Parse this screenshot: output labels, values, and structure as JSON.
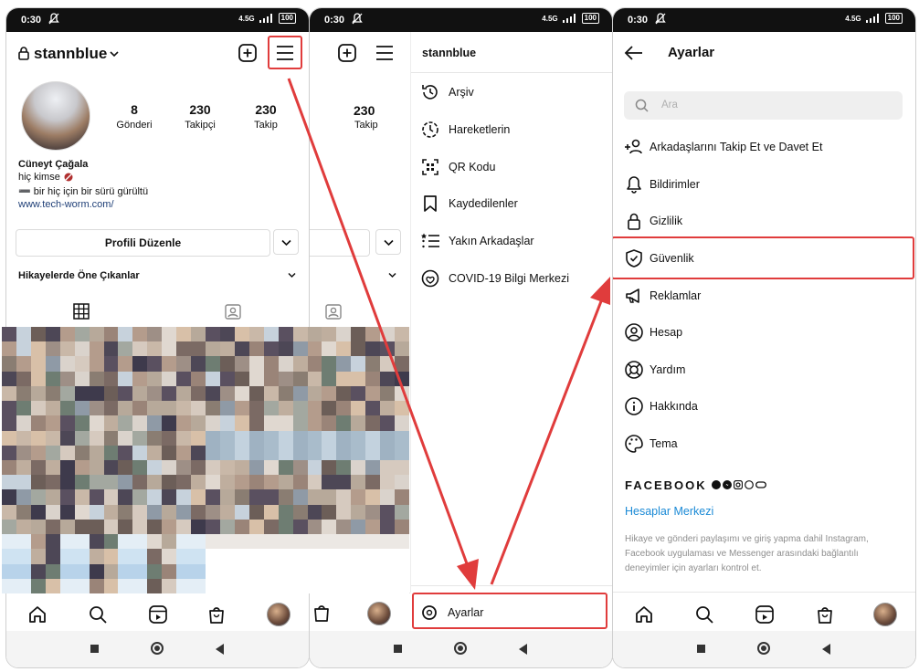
{
  "status": {
    "time": "0:30",
    "battery": "100",
    "signal": "4.5G"
  },
  "profile": {
    "username": "stannblue",
    "stats": [
      {
        "value": "8",
        "label": "Gönderi"
      },
      {
        "value": "230",
        "label": "Takipçi"
      },
      {
        "value": "230",
        "label": "Takip"
      }
    ],
    "name": "Cüneyt Çağala",
    "bio_line1": "hiç kimse",
    "bio_line2": "➖ bir hiç için bir sürü gürültü",
    "website": "www.tech-worm.com/",
    "edit_button": "Profili Düzenle",
    "highlights": "Hikayelerde Öne Çıkanlar"
  },
  "middle": {
    "username": "stannblue",
    "stat_value": "230",
    "stat_label": "Takip",
    "menu": [
      {
        "label": "Arşiv",
        "icon": "archive-icon"
      },
      {
        "label": "Hareketlerin",
        "icon": "activity-icon"
      },
      {
        "label": "QR Kodu",
        "icon": "qr-code-icon"
      },
      {
        "label": "Kaydedilenler",
        "icon": "bookmark-icon"
      },
      {
        "label": "Yakın Arkadaşlar",
        "icon": "close-friends-icon"
      },
      {
        "label": "COVID-19 Bilgi Merkezi",
        "icon": "covid-info-icon"
      }
    ],
    "settings": "Ayarlar"
  },
  "settings": {
    "title": "Ayarlar",
    "search_placeholder": "Ara",
    "items": [
      {
        "label": "Arkadaşlarını Takip Et ve Davet Et",
        "icon": "add-person-icon"
      },
      {
        "label": "Bildirimler",
        "icon": "bell-icon"
      },
      {
        "label": "Gizlilik",
        "icon": "lock-icon"
      },
      {
        "label": "Güvenlik",
        "icon": "shield-icon"
      },
      {
        "label": "Reklamlar",
        "icon": "megaphone-icon"
      },
      {
        "label": "Hesap",
        "icon": "account-icon"
      },
      {
        "label": "Yardım",
        "icon": "lifebuoy-icon"
      },
      {
        "label": "Hakkında",
        "icon": "info-icon"
      },
      {
        "label": "Tema",
        "icon": "palette-icon"
      }
    ],
    "facebook": "FACEBOOK",
    "accounts_center": "Hesaplar Merkezi",
    "footer": [
      "Hikaye ve gönderi paylaşımı ve giriş yapma dahil Instagram,",
      "Facebook uygulaması ve Messenger arasındaki bağlantılı",
      "deneyimler için ayarları kontrol et."
    ]
  },
  "colors": {
    "highlight": "#e03c3c",
    "link": "#1f5aa6",
    "accent": "#1b8ad6"
  }
}
